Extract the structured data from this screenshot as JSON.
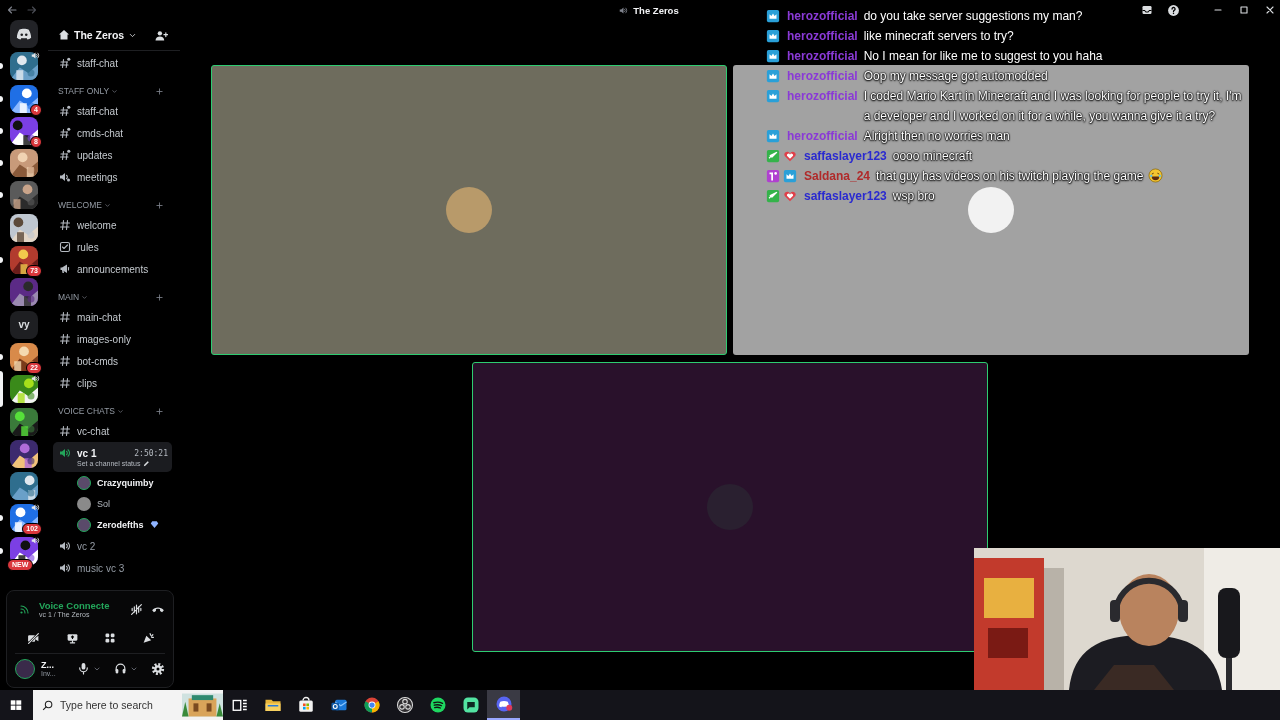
{
  "window": {
    "title": "The Zeros"
  },
  "servers": [
    {
      "kind": "home",
      "unread": false,
      "selected": false,
      "speaking": false
    },
    {
      "kind": "picture",
      "unread": true,
      "selected": false,
      "speaking": true
    },
    {
      "kind": "picture",
      "unread": true,
      "selected": false,
      "speaking": false,
      "badge": "4"
    },
    {
      "kind": "picture",
      "unread": true,
      "selected": false,
      "speaking": false,
      "badge": "8"
    },
    {
      "kind": "picture",
      "unread": true,
      "selected": false,
      "speaking": false
    },
    {
      "kind": "picture",
      "unread": true,
      "selected": false,
      "speaking": false
    },
    {
      "kind": "picture",
      "unread": false,
      "selected": false,
      "speaking": false
    },
    {
      "kind": "picture",
      "unread": true,
      "selected": false,
      "speaking": false,
      "badge": "73"
    },
    {
      "kind": "picture",
      "unread": false,
      "selected": false,
      "speaking": false
    },
    {
      "kind": "initials",
      "label": "vy",
      "unread": false,
      "selected": false,
      "speaking": false
    },
    {
      "kind": "picture",
      "unread": true,
      "selected": false,
      "speaking": false,
      "badge": "22"
    },
    {
      "kind": "picture",
      "unread": false,
      "selected": true,
      "speaking": true
    },
    {
      "kind": "picture",
      "unread": false,
      "selected": false,
      "speaking": false
    },
    {
      "kind": "picture",
      "unread": false,
      "selected": false,
      "speaking": false
    },
    {
      "kind": "picture",
      "unread": false,
      "selected": false,
      "speaking": false
    },
    {
      "kind": "picture",
      "unread": true,
      "selected": false,
      "speaking": true,
      "badge": "102"
    },
    {
      "kind": "picture",
      "unread": true,
      "selected": false,
      "speaking": true,
      "tag": "NEW"
    }
  ],
  "server_header": {
    "name": "The Zeros"
  },
  "channel_list": {
    "top_channels": [
      {
        "name": "staff-chat",
        "kind": "private",
        "selected": false
      }
    ],
    "categories": [
      {
        "name": "STAFF ONLY",
        "channels": [
          {
            "name": "staff-chat",
            "kind": "private",
            "selected": false
          },
          {
            "name": "cmds-chat",
            "kind": "private",
            "selected": false
          },
          {
            "name": "updates",
            "kind": "private",
            "selected": false
          },
          {
            "name": "meetings",
            "kind": "stage",
            "selected": false
          }
        ]
      },
      {
        "name": "WELCOME",
        "channels": [
          {
            "name": "welcome",
            "kind": "text",
            "selected": false
          },
          {
            "name": "rules",
            "kind": "rules",
            "selected": false
          },
          {
            "name": "announcements",
            "kind": "announcement",
            "selected": false
          }
        ]
      },
      {
        "name": "MAIN",
        "channels": [
          {
            "name": "main-chat",
            "kind": "text",
            "selected": false
          },
          {
            "name": "images-only",
            "kind": "text",
            "selected": false
          },
          {
            "name": "bot-cmds",
            "kind": "text",
            "selected": false
          },
          {
            "name": "clips",
            "kind": "text",
            "selected": false
          }
        ]
      },
      {
        "name": "VOICE CHATS",
        "channels": [
          {
            "name": "vc-chat",
            "kind": "text",
            "selected": false
          },
          {
            "name": "vc 1",
            "kind": "voice",
            "selected": true,
            "timer": "2:50:21",
            "status": "Set a channel status",
            "members": [
              {
                "name": "Crazyquimby",
                "speaking": true,
                "gem": false
              },
              {
                "name": "Sol",
                "speaking": false,
                "gem": false
              },
              {
                "name": "Zerodefths",
                "speaking": true,
                "gem": true
              }
            ]
          },
          {
            "name": "vc 2",
            "kind": "voice",
            "selected": false
          },
          {
            "name": "music vc 3",
            "kind": "voice",
            "selected": false
          }
        ]
      }
    ]
  },
  "voice_panel": {
    "status": "Voice Connecte",
    "channel": "vc 1 / The Zeros"
  },
  "user_panel": {
    "name": "Z...",
    "status": "Inv..."
  },
  "tiles": [
    {
      "speaking": true,
      "color": "#6e6c5d"
    },
    {
      "speaking": false,
      "color": "#a2a2a2"
    },
    {
      "speaking": true,
      "color": "#29112b"
    }
  ],
  "chat_overlay": {
    "messages": [
      {
        "badges": [
          {
            "kind": "crown"
          }
        ],
        "user": "herozofficial",
        "color": "#8a3ad6",
        "text": "do you take server suggestions my man?"
      },
      {
        "badges": [
          {
            "kind": "crown"
          }
        ],
        "user": "herozofficial",
        "color": "#8a3ad6",
        "text": "like minecraft servers to try?"
      },
      {
        "badges": [
          {
            "kind": "crown"
          }
        ],
        "user": "herozofficial",
        "color": "#8a3ad6",
        "text": "No I mean for like me to suggest to you haha"
      },
      {
        "badges": [
          {
            "kind": "crown"
          }
        ],
        "user": "herozofficial",
        "color": "#8a3ad6",
        "text": "Oop my message got automodded"
      },
      {
        "badges": [
          {
            "kind": "crown"
          }
        ],
        "user": "herozofficial",
        "color": "#8a3ad6",
        "text": "I coded Mario Kart in Minecraft and I was looking for people to try it, I'm a developer and I worked on it for a while, you wanna give it a try?"
      },
      {
        "badges": [
          {
            "kind": "crown"
          }
        ],
        "user": "herozofficial",
        "color": "#8a3ad6",
        "text": "Alright then no worries man"
      },
      {
        "badges": [
          {
            "kind": "sword"
          },
          {
            "kind": "heart"
          }
        ],
        "user": "saffaslayer123",
        "color": "#2a2ad0",
        "text": "oooo minecraft"
      },
      {
        "badges": [
          {
            "kind": "first"
          },
          {
            "kind": "crown"
          }
        ],
        "user": "Saldana_24",
        "color": "#b02a2a",
        "text": "that guy has videos on his twitch playing the game",
        "emoji": {
          "kind": "laughing"
        }
      },
      {
        "badges": [
          {
            "kind": "sword"
          },
          {
            "kind": "heart"
          }
        ],
        "user": "saffaslayer123",
        "color": "#2a2ad0",
        "text": "wsp bro"
      }
    ]
  },
  "webcam": {
    "kind": "picture"
  },
  "taskbar": {
    "search": {
      "placeholder": "Type here to search"
    },
    "apps": [
      {
        "kind": "taskview",
        "selected": false
      },
      {
        "kind": "folder",
        "selected": false
      },
      {
        "kind": "store",
        "selected": false
      },
      {
        "kind": "mail",
        "selected": false
      },
      {
        "kind": "chrome",
        "selected": false
      },
      {
        "kind": "obs",
        "selected": false
      },
      {
        "kind": "spotify",
        "selected": false
      },
      {
        "kind": "greenapp",
        "selected": false
      },
      {
        "kind": "discord",
        "selected": true
      }
    ]
  }
}
